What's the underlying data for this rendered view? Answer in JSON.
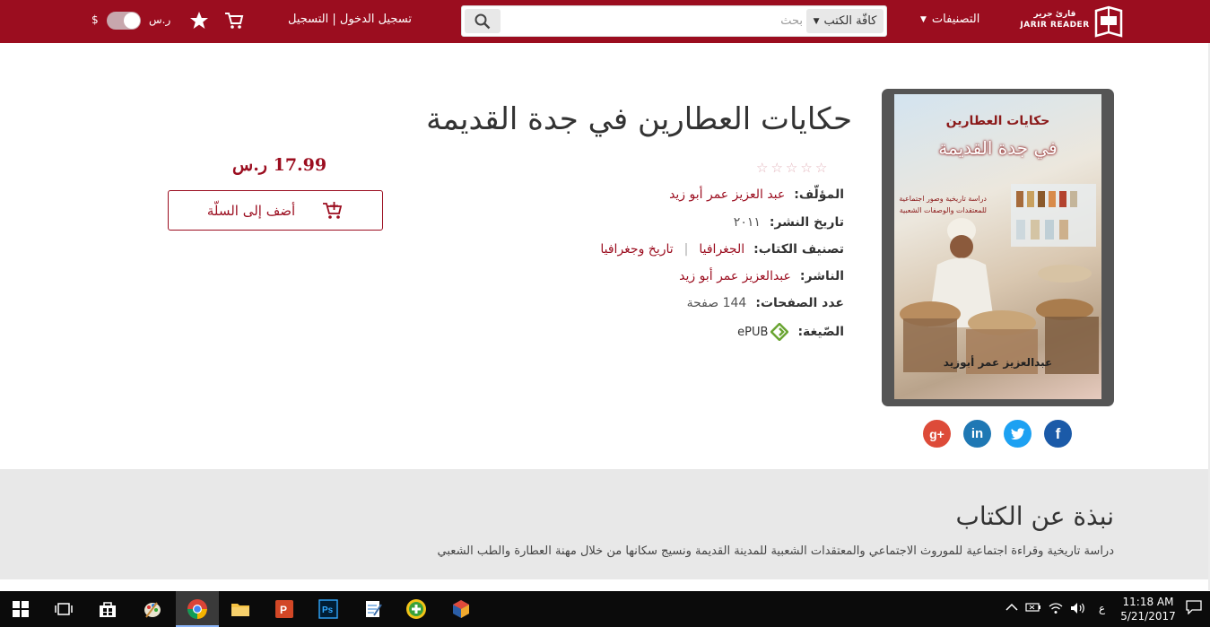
{
  "header": {
    "logo_ar": "قارئ جرير",
    "logo_en": "JARIR READER",
    "categories_label": "التصنيفات",
    "search": {
      "category": "كافّة الكتب",
      "placeholder": "بحث"
    },
    "login_label": "تسجيل الدخول | التسجيل",
    "currency_sar": "ر.س",
    "currency_usd": "$"
  },
  "book": {
    "title": "حكايات العطارين في جدة القديمة",
    "price": "17.99 ر.س",
    "add_to_cart": "أضف إلى السلّة",
    "rating": 0,
    "cover": {
      "title_line1": "حكايات العطارين",
      "title_line2": "في جدة القديمة",
      "subtitle": "دراسة تاريخية وصور اجتماعية للمعتقدات والوصفات الشعبية",
      "author": "عبدالعزيز عمر أبوزيد"
    },
    "meta": {
      "author_label": "المؤلّف:",
      "author": "عبد العزيز عمر أبو زيد",
      "date_label": "تاريخ النشر:",
      "date": "٢٠١١",
      "category_label": "تصنيف الكتاب:",
      "category1": "الجغرافيا",
      "category2": "تاريخ وجغرافيا",
      "publisher_label": "الناشر:",
      "publisher": "عبدالعزيز عمر أبو زيد",
      "pages_label": "عدد الصفحات:",
      "pages": "144 صفحة",
      "format_label": "الصّيغة:",
      "format": "ePUB"
    }
  },
  "about": {
    "title": "نبذة عن الكتاب",
    "text": "دراسة تاريخية وقراءة اجتماعية للموروث الاجتماعي والمعتقدات الشعبية للمدينة القديمة ونسيج سكانها من خلال مهنة العطارة والطب الشعبي"
  },
  "taskbar": {
    "lang": "ع",
    "time": "11:18 AM",
    "date": "5/21/2017"
  },
  "colors": {
    "brand": "#9b0d1f"
  }
}
